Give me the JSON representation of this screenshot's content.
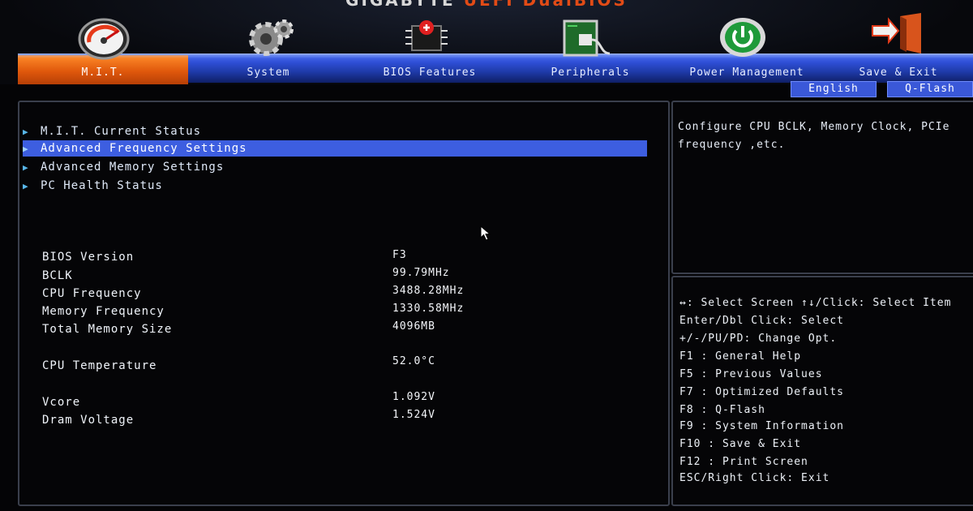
{
  "header": {
    "brand_prefix": "GIGABYTE",
    "brand_suffix": "UEFI DualBIOS",
    "tabs": [
      {
        "label": "M.I.T.",
        "icon": "speedometer-icon",
        "active": true
      },
      {
        "label": "System",
        "icon": "gear-icon",
        "active": false
      },
      {
        "label": "BIOS Features",
        "icon": "chip-icon",
        "active": false
      },
      {
        "label": "Peripherals",
        "icon": "connector-icon",
        "active": false
      },
      {
        "label": "Power Management",
        "icon": "power-icon",
        "active": false
      },
      {
        "label": "Save & Exit",
        "icon": "exit-door-icon",
        "active": false
      }
    ],
    "language_button": "English",
    "qflash_button": "Q-Flash"
  },
  "menu": {
    "items": [
      {
        "label": "M.I.T. Current Status",
        "selected": false
      },
      {
        "label": "Advanced Frequency Settings",
        "selected": true
      },
      {
        "label": "Advanced Memory Settings",
        "selected": false
      },
      {
        "label": "PC Health Status",
        "selected": false
      }
    ]
  },
  "info": {
    "rows": [
      {
        "label": "BIOS Version",
        "value": "F3"
      },
      {
        "label": "BCLK",
        "value": "99.79MHz"
      },
      {
        "label": "CPU Frequency",
        "value": "3488.28MHz"
      },
      {
        "label": "Memory Frequency",
        "value": "1330.58MHz"
      },
      {
        "label": "Total Memory Size",
        "value": "4096MB"
      },
      {
        "label": "CPU Temperature",
        "value": "52.0°C"
      },
      {
        "label": "Vcore",
        "value": "1.092V"
      },
      {
        "label": "Dram Voltage",
        "value": "1.524V"
      }
    ]
  },
  "description": {
    "text": "Configure CPU BCLK, Memory Clock, PCIe frequency ,etc."
  },
  "help": {
    "lines": [
      "↔: Select Screen  ↑↓/Click: Select Item",
      "Enter/Dbl Click: Select",
      "+/-/PU/PD: Change Opt.",
      "F1  : General Help",
      "F5  : Previous Values",
      "F7  : Optimized Defaults",
      "F8  : Q-Flash",
      "F9  : System Information",
      "F10 : Save & Exit",
      "F12 : Print Screen",
      "ESC/Right Click: Exit"
    ]
  },
  "colors": {
    "accent_orange": "#e0580c",
    "band_blue": "#2f4fd6",
    "selection_blue": "#3d5ee0",
    "arrow_cyan": "#58b6e8"
  }
}
